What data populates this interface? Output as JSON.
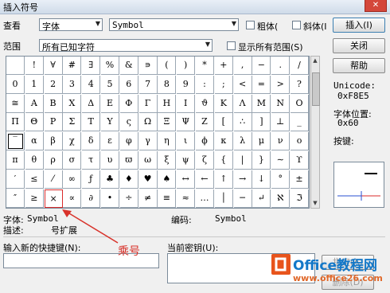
{
  "window": {
    "title": "插入符号",
    "close_label": "✕"
  },
  "view": {
    "label": "查看",
    "font_label": "字体",
    "font_value": "Symbol",
    "bold_label": "粗体(",
    "italic_label": "斜体(I"
  },
  "range": {
    "label": "范围",
    "value": "所有已知字符",
    "show_all_label": "显示所有范围(S)"
  },
  "buttons": {
    "insert": "插入(I)",
    "close": "关闭",
    "help": "帮助",
    "assign": "指定(A)",
    "delete": "删除(D)"
  },
  "grid": {
    "rows": [
      [
        "",
        "!",
        "∀",
        "#",
        "∃",
        "%",
        "&",
        "∍",
        "(",
        ")",
        "*",
        "+",
        ",",
        "−",
        ".",
        "/"
      ],
      [
        "0",
        "1",
        "2",
        "3",
        "4",
        "5",
        "6",
        "7",
        "8",
        "9",
        ":",
        ";",
        "<",
        "=",
        ">",
        "?"
      ],
      [
        "≅",
        "Α",
        "Β",
        "Χ",
        "Δ",
        "Ε",
        "Φ",
        "Γ",
        "Η",
        "Ι",
        "ϑ",
        "Κ",
        "Λ",
        "Μ",
        "Ν",
        "Ο"
      ],
      [
        "Π",
        "Θ",
        "Ρ",
        "Σ",
        "Τ",
        "Υ",
        "ς",
        "Ω",
        "Ξ",
        "Ψ",
        "Ζ",
        "[",
        "∴",
        "]",
        "⊥",
        "_"
      ],
      [
        "‾",
        "α",
        "β",
        "χ",
        "δ",
        "ε",
        "φ",
        "γ",
        "η",
        "ι",
        "ϕ",
        "κ",
        "λ",
        "μ",
        "ν",
        "ο"
      ],
      [
        "π",
        "θ",
        "ρ",
        "σ",
        "τ",
        "υ",
        "ϖ",
        "ω",
        "ξ",
        "ψ",
        "ζ",
        "{",
        "|",
        "}",
        "∼",
        "ϒ"
      ],
      [
        "′",
        "≤",
        "⁄",
        "∞",
        "ƒ",
        "♣",
        "♦",
        "♥",
        "♠",
        "↔",
        "←",
        "↑",
        "→",
        "↓",
        "°",
        "±"
      ],
      [
        "″",
        "≥",
        "×",
        "∝",
        "∂",
        "•",
        "÷",
        "≠",
        "≡",
        "≈",
        "…",
        "│",
        "─",
        "↵",
        "ℵ",
        "ℑ"
      ]
    ]
  },
  "info": {
    "unicode_label": "Unicode:",
    "unicode_value": "0xF8E5",
    "pos_label": "字体位置:",
    "pos_value": "0x60",
    "key_label": "按键:"
  },
  "status": {
    "font_label": "字体:",
    "font_value": "Symbol",
    "code_label": "编码:",
    "code_value": "Symbol",
    "desc_label": "描述:",
    "desc_value": "号扩展"
  },
  "shortcut": {
    "new_key_label": "输入新的快捷键(N):",
    "current_key_label": "当前密钥(U):"
  },
  "annotation": {
    "text": "乘号"
  },
  "watermark": {
    "brand": "Office教程网",
    "url": "www.office26.com"
  }
}
